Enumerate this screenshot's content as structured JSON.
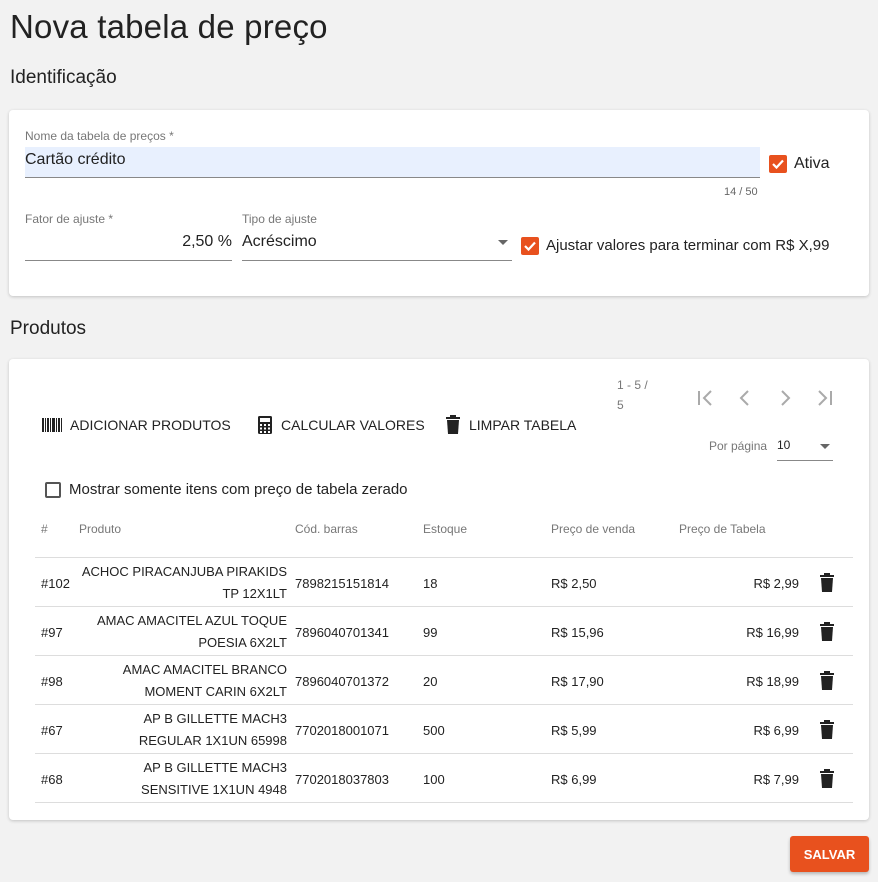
{
  "page": {
    "title": "Nova tabela de preço"
  },
  "identificacao": {
    "section_title": "Identificação",
    "nome_label": "Nome da tabela de preços *",
    "nome_value": "Cartão crédito",
    "nome_counter": "14 / 50",
    "ativa_label": "Ativa",
    "ativa_checked": true,
    "fator_label": "Fator de ajuste *",
    "fator_value": "2,50 %",
    "tipo_label": "Tipo de ajuste",
    "tipo_value": "Acréscimo",
    "ajustar_label": "Ajustar valores para terminar com R$ X,99",
    "ajustar_checked": true
  },
  "produtos": {
    "section_title": "Produtos",
    "toolbar": {
      "adicionar_label": "ADICIONAR PRODUTOS",
      "calcular_label": "CALCULAR VALORES",
      "limpar_label": "LIMPAR TABELA"
    },
    "pagination": {
      "range_line1": "1 - 5 /",
      "range_line2": "5",
      "per_page_label": "Por página",
      "per_page_value": "10"
    },
    "filter_label": "Mostrar somente itens com preço de tabela zerado",
    "filter_checked": false,
    "columns": [
      "#",
      "Produto",
      "Cód. barras",
      "Estoque",
      "Preço de venda",
      "Preço de Tabela"
    ],
    "rows": [
      {
        "id": "#102",
        "produto_l1": "ACHOC PIRACANJUBA PIRAKIDS",
        "produto_l2": "TP 12X1LT",
        "barras": "7898215151814",
        "estoque": "18",
        "venda": "R$ 2,50",
        "tabela": "R$ 2,99"
      },
      {
        "id": "#97",
        "produto_l1": "AMAC AMACITEL AZUL TOQUE",
        "produto_l2": "POESIA 6X2LT",
        "barras": "7896040701341",
        "estoque": "99",
        "venda": "R$ 15,96",
        "tabela": "R$ 16,99"
      },
      {
        "id": "#98",
        "produto_l1": "AMAC AMACITEL BRANCO",
        "produto_l2": "MOMENT CARIN 6X2LT",
        "barras": "7896040701372",
        "estoque": "20",
        "venda": "R$ 17,90",
        "tabela": "R$ 18,99"
      },
      {
        "id": "#67",
        "produto_l1": "AP B GILLETTE MACH3",
        "produto_l2": "REGULAR 1X1UN 65998",
        "barras": "7702018001071",
        "estoque": "500",
        "venda": "R$ 5,99",
        "tabela": "R$ 6,99"
      },
      {
        "id": "#68",
        "produto_l1": "AP B GILLETTE MACH3",
        "produto_l2": "SENSITIVE 1X1UN 4948",
        "barras": "7702018037803",
        "estoque": "100",
        "venda": "R$ 6,99",
        "tabela": "R$ 7,99"
      }
    ]
  },
  "footer": {
    "save_label": "SALVAR"
  },
  "colors": {
    "accent": "#e8511e",
    "input_bg": "#e8f0fe"
  }
}
